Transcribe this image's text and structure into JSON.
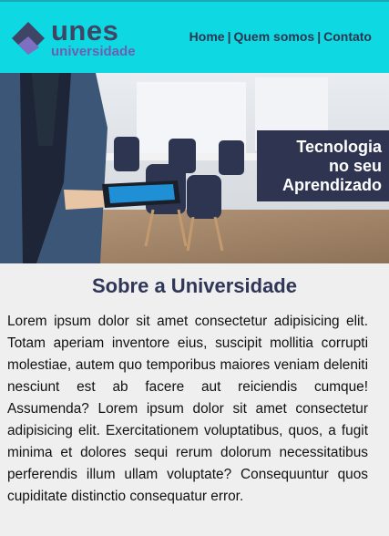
{
  "header": {
    "logo": {
      "brand": "unes",
      "subtitle": "universidade"
    },
    "nav": [
      {
        "label": "Home"
      },
      {
        "label": "Quem somos"
      },
      {
        "label": "Contato"
      }
    ],
    "nav_separator": "|"
  },
  "hero": {
    "caption_lines": [
      "Tecnologia",
      "no seu",
      "Aprendizado"
    ],
    "colors": {
      "caption_bg": "#2f3450"
    }
  },
  "main": {
    "heading": "Sobre a Universidade",
    "text": "Lorem ipsum dolor sit amet consectetur adipisicing elit. Totam aperiam inventore eius, suscipit mollitia corrupti molestiae, autem quo temporibus maiores veniam deleniti nesciunt est ab facere aut reiciendis cumque! Assumenda? Lorem ipsum dolor sit amet consectetur adipisicing elit. Exercitationem voluptatibus, quos, a fugit minima et dolores sequi rerum dolorum necessitatibus perferendis illum ullam voluptate? Consequuntur quos cupiditate distinctio consequatur error."
  },
  "colors": {
    "header_bg": "#0ed9e2",
    "heading": "#2f3657",
    "logo_dark": "#3f4565",
    "logo_accent": "#6d5fb0"
  }
}
